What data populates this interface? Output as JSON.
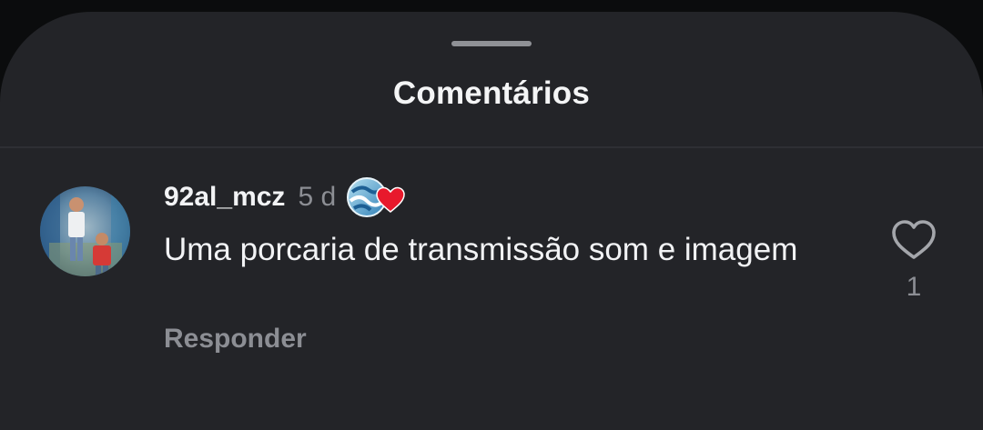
{
  "sheet": {
    "title": "Comentários"
  },
  "comment": {
    "username": "92al_mcz",
    "time_ago": "5 d",
    "text": "Uma porcaria de transmissão som e imagem",
    "reply_label": "Responder",
    "like_count": "1",
    "avatar": "user-avatar-photo",
    "badge": "globe-heart-badge-icon",
    "like_icon": "heart-outline-icon"
  },
  "colors": {
    "background": "#0b0c0d",
    "sheet": "#232428",
    "primary_text": "#f2f3f5",
    "secondary_text": "#8c8e94",
    "badge_heart": "#e8192c"
  }
}
